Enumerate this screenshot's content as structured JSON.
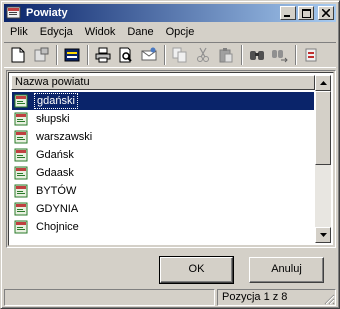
{
  "window": {
    "title": "Powiaty"
  },
  "menu": [
    "Plik",
    "Edycja",
    "Widok",
    "Dane",
    "Opcje"
  ],
  "toolbar": {
    "icons": [
      "new-document-icon",
      "properties-icon",
      "edit-form-icon",
      "print-icon",
      "print-preview-icon",
      "email-icon",
      "copy-icon",
      "cut-icon",
      "paste-icon",
      "find-icon",
      "find-replace-icon",
      "more-icon"
    ]
  },
  "list": {
    "column_header": "Nazwa powiatu",
    "items": [
      "gdański",
      "słupski",
      "warszawski",
      "Gdańsk",
      "Gdaask",
      "BYTÓW",
      "GDYNIA",
      "Chojnice"
    ],
    "selected_index": 0
  },
  "buttons": {
    "ok": "OK",
    "cancel": "Anuluj"
  },
  "status": {
    "left": "",
    "position": "Pozycja 1 z 8"
  },
  "colors": {
    "title_start": "#0a246a",
    "title_end": "#a6caf0",
    "selection": "#0a246a",
    "face": "#d4d0c8"
  }
}
